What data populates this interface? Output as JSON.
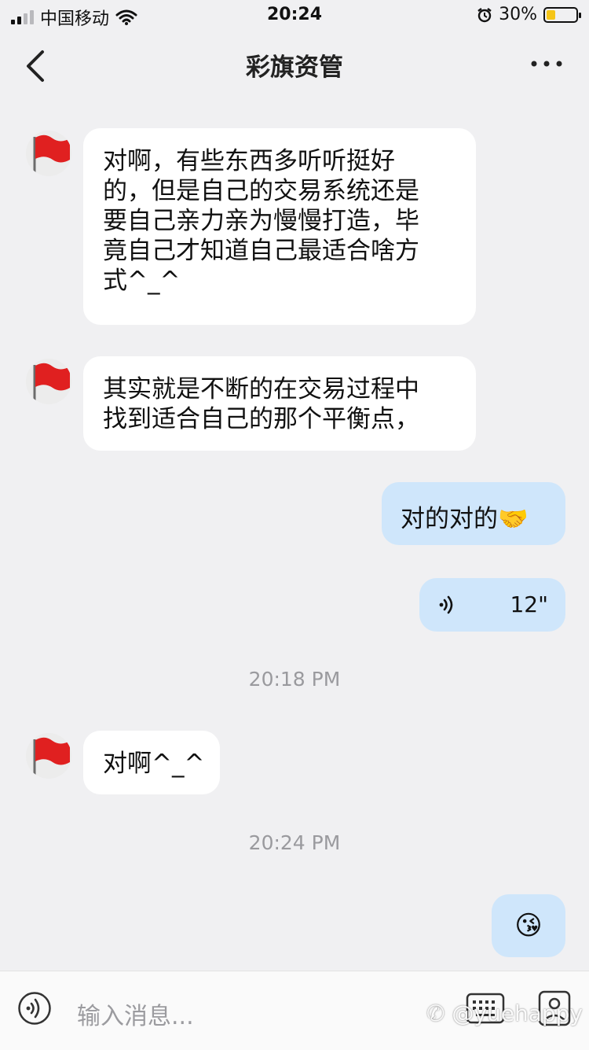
{
  "status_bar": {
    "carrier": "中国移动",
    "time": "20:24",
    "battery_percent_label": "30%",
    "battery_level": 0.3,
    "battery_color": "#f5c518"
  },
  "nav": {
    "title": "彩旗资管",
    "back_icon": "chevron-left-icon",
    "more_icon": "more-dots-icon"
  },
  "messages": {
    "m1": {
      "lines": [
        "对啊，有些东西多听听挺好",
        "的，但是自己的交易系统还是",
        "要自己亲力亲为慢慢打造，毕",
        "竟自己才知道自己最适合啥方",
        "式^_^"
      ]
    },
    "m2": {
      "lines": [
        "其实就是不断的在交易过程中",
        "找到适合自己的那个平衡点，"
      ]
    },
    "m3": {
      "text": "对的对的",
      "emoji": "🤝"
    },
    "m4": {
      "duration": "12\""
    },
    "ts1": "20:18 PM",
    "m5": {
      "text": "对啊^_^"
    },
    "ts2": "20:24 PM",
    "m6": {
      "emoji": "😘"
    }
  },
  "input_bar": {
    "placeholder": "输入消息...",
    "voice_icon": "voice-icon",
    "keyboard_icon": "keyboard-icon",
    "photo_icon": "photo-icon"
  },
  "watermark": "@yuehappy",
  "colors": {
    "background": "#f0f0f2",
    "incoming_bubble": "#ffffff",
    "outgoing_bubble": "#cfe6fb",
    "flag_red": "#e02020"
  }
}
